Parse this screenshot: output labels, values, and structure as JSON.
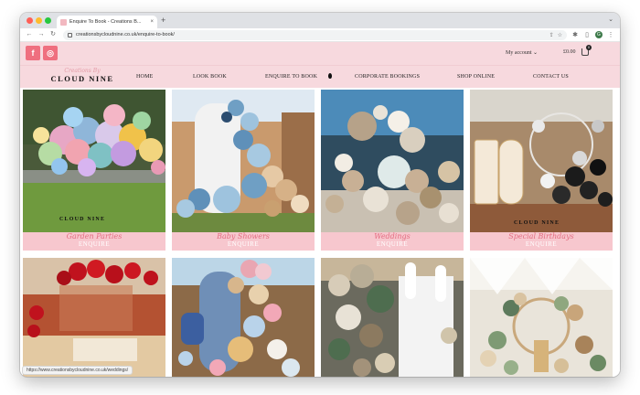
{
  "browser": {
    "tab_title": "Enquire To Book - Creations B...",
    "tab_close": "×",
    "new_tab": "+",
    "url": "creationsbycloudnine.co.uk/enquire-to-book/",
    "status_url": "https://www.creationsbycloudnine.co.uk/weddings/",
    "profile_initial": "G",
    "icons": [
      "back-icon",
      "forward-icon",
      "reload-icon",
      "lock-icon",
      "share-icon",
      "star-icon",
      "extensions-icon",
      "profile-icon",
      "menu-icon"
    ]
  },
  "topbar": {
    "social": [
      {
        "name": "facebook",
        "glyph": "f"
      },
      {
        "name": "instagram",
        "glyph": "◎"
      }
    ],
    "account_label": "My account",
    "account_chevron": "⌄",
    "cart_total": "£0.00",
    "cart_count": "0"
  },
  "nav": {
    "logo_script": "Creations By",
    "logo_main": "CLOUD NINE",
    "items": [
      "HOME",
      "LOOK BOOK",
      "ENQUIRE TO BOOK",
      "CORPORATE BOOKINGS",
      "SHOP ONLINE",
      "CONTACT US"
    ]
  },
  "cards": [
    {
      "title": "Garden Parties",
      "cta": "ENQUIRE",
      "badge": "CLOUD NINE"
    },
    {
      "title": "Baby Showers",
      "cta": "ENQUIRE"
    },
    {
      "title": "Weddings",
      "cta": "ENQUIRE"
    },
    {
      "title": "Special Birthdays",
      "cta": "ENQUIRE",
      "badge": "CLOUD NINE"
    }
  ],
  "colors": {
    "brand_pink": "#f7d9de",
    "caption_band": "#f7c7ce",
    "script_pink": "#e36c80",
    "social_button": "#ef6f7f"
  }
}
